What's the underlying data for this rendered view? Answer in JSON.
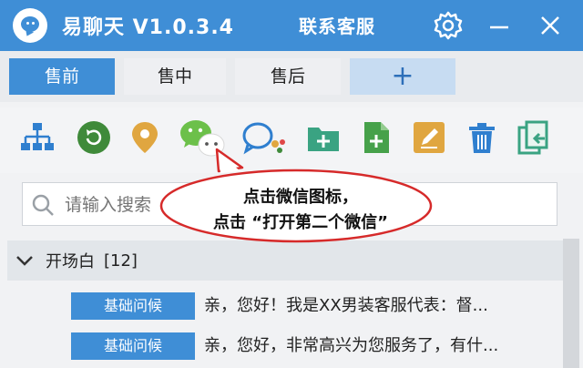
{
  "titlebar": {
    "app_name": "易聊天 V1.0.3.4",
    "center_title": "联系客服"
  },
  "tabs": [
    {
      "label": "售前",
      "active": true
    },
    {
      "label": "售中",
      "active": false
    },
    {
      "label": "售后",
      "active": false
    },
    {
      "label": "+",
      "active": false
    }
  ],
  "toolbar": {
    "icons": [
      "org-chart-icon",
      "refresh-icon",
      "location-icon",
      "wechat-icon",
      "chat-bubbles-icon",
      "new-folder-icon",
      "new-file-icon",
      "edit-icon",
      "trash-icon",
      "import-icon"
    ]
  },
  "search": {
    "placeholder": "请输入搜索"
  },
  "group": {
    "title": "开场白",
    "count": "[12]"
  },
  "rows": [
    {
      "tag": "基础问候",
      "text": "亲，您好！我是XX男装客服代表：督..."
    },
    {
      "tag": "基础问候",
      "text": "亲，您好，非常高兴为您服务了，有什..."
    }
  ],
  "callout": {
    "line1": "点击微信图标，",
    "line2": "点击 “打开第二个微信”"
  },
  "colors": {
    "accent": "#3f8ed6",
    "callout_border": "#d62a2a"
  }
}
